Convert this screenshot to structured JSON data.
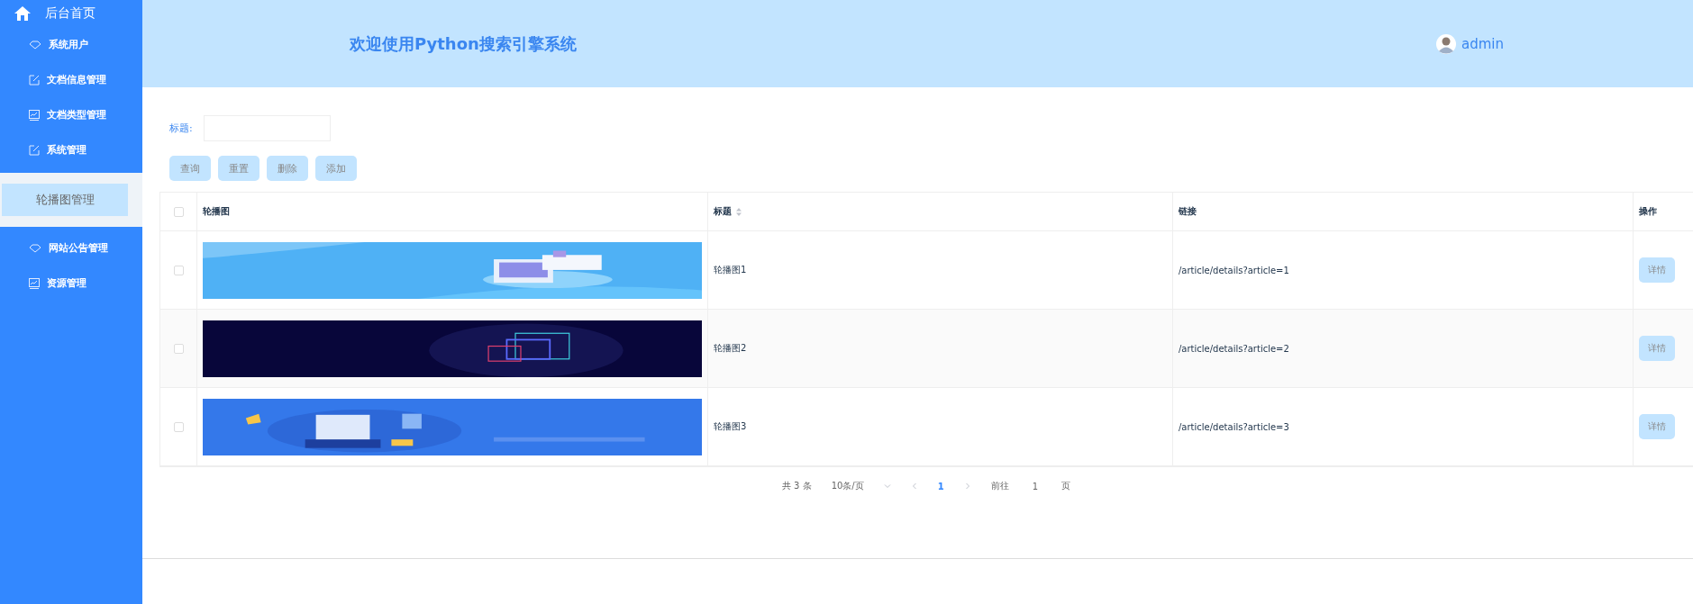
{
  "sidebar": {
    "home": "后台首页",
    "items": [
      {
        "label": "系统用户",
        "kind": "diamond",
        "selected": false
      },
      {
        "label": "文档信息管理",
        "kind": "edit",
        "selected": false
      },
      {
        "label": "文档类型管理",
        "kind": "chart",
        "selected": false
      },
      {
        "label": "系统管理",
        "kind": "edit",
        "selected": false
      },
      {
        "label": "轮播图管理",
        "kind": "plain",
        "selected": true
      },
      {
        "label": "网站公告管理",
        "kind": "diamond",
        "selected": false
      },
      {
        "label": "资源管理",
        "kind": "chart",
        "selected": false
      }
    ]
  },
  "header": {
    "title": "欢迎使用Python搜索引擎系统",
    "user": "admin"
  },
  "filter": {
    "label": "标题:"
  },
  "buttons": [
    "查询",
    "重置",
    "删除",
    "添加"
  ],
  "table": {
    "columns": [
      "轮播图",
      "标题",
      "链接",
      "操作"
    ],
    "header_checked": false,
    "rows": [
      {
        "checked": false,
        "title": "轮播图1",
        "link": "/article/details?article=1",
        "action": "详情"
      },
      {
        "checked": false,
        "title": "轮播图2",
        "link": "/article/details?article=2",
        "action": "详情"
      },
      {
        "checked": false,
        "title": "轮播图3",
        "link": "/article/details?article=3",
        "action": "详情"
      }
    ]
  },
  "pagination": {
    "total": "共 3 条",
    "page_size": "10条/页",
    "pages": [
      {
        "label": "1",
        "selected": true
      }
    ],
    "goto": "前往",
    "goto_value": "1",
    "goto_suffix": "页"
  }
}
